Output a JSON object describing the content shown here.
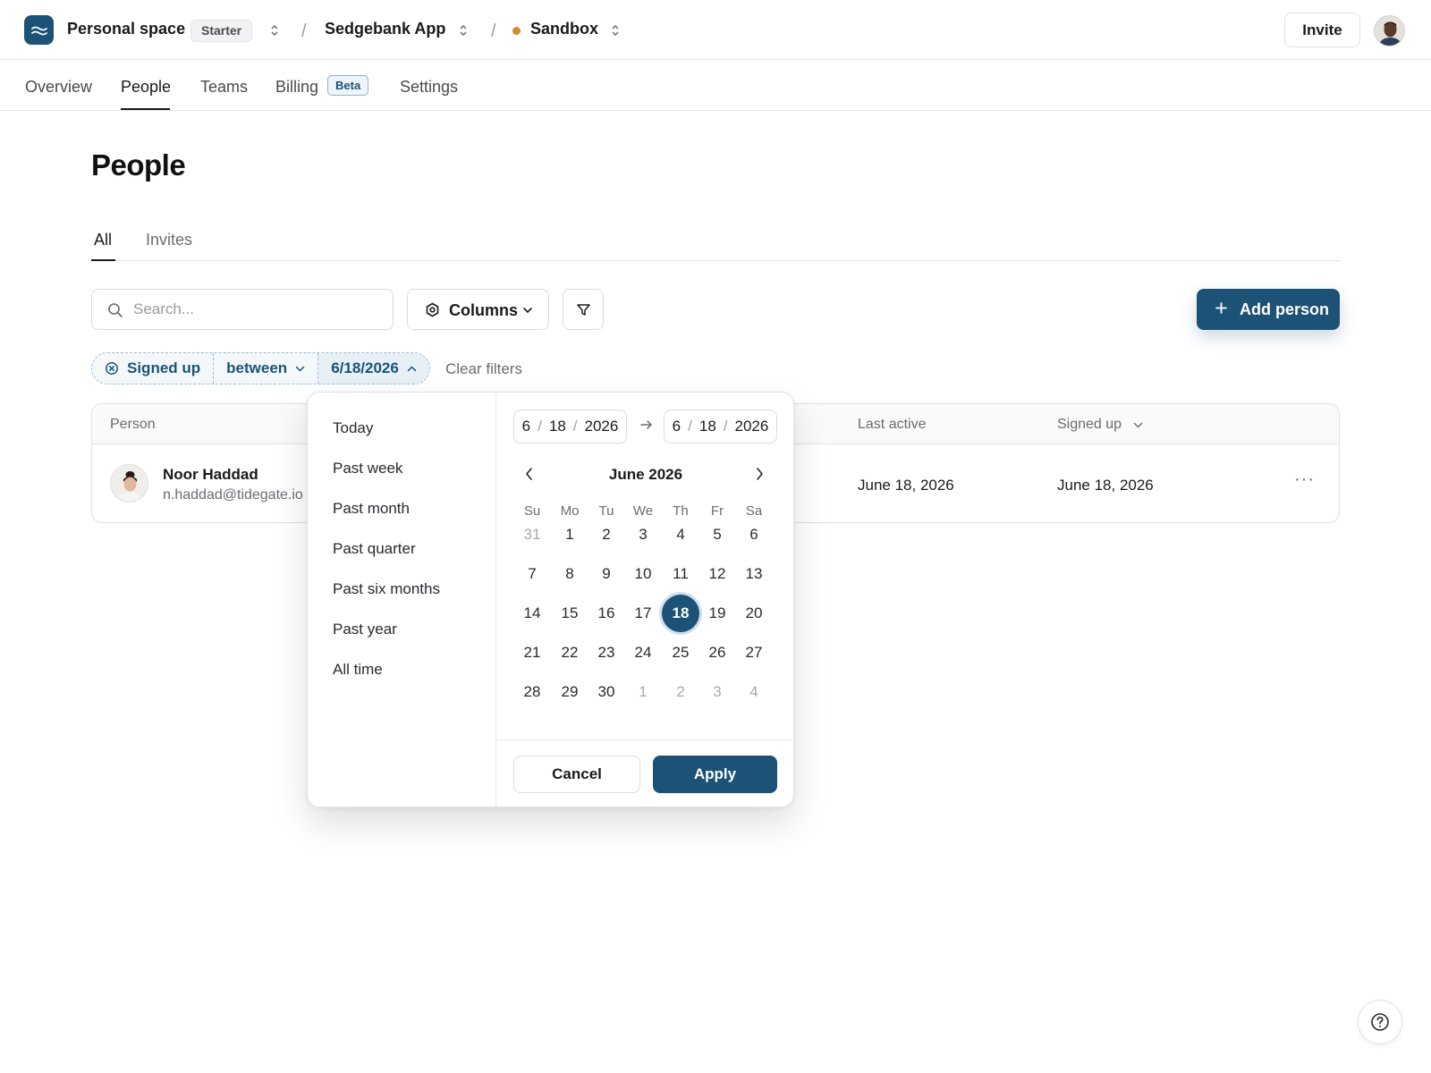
{
  "topbar": {
    "workspace": "Personal space",
    "plan": "Starter",
    "app": "Sedgebank App",
    "environment": "Sandbox",
    "environment_color": "#d18a2c",
    "invite_label": "Invite",
    "brand_color": "#1b5276"
  },
  "nav": {
    "tabs": [
      {
        "label": "Overview"
      },
      {
        "label": "People",
        "active": true
      },
      {
        "label": "Teams"
      },
      {
        "label": "Billing",
        "badge": "Beta"
      },
      {
        "label": "Settings"
      }
    ]
  },
  "page": {
    "title": "People",
    "subtabs": [
      {
        "label": "All",
        "active": true
      },
      {
        "label": "Invites"
      }
    ]
  },
  "toolbar": {
    "search_placeholder": "Search...",
    "columns_label": "Columns",
    "add_label": "Add person"
  },
  "filter": {
    "field": "Signed up",
    "operator": "between",
    "value": "6/18/2026",
    "clear_label": "Clear filters"
  },
  "table": {
    "headers": [
      "Person",
      "Last active",
      "Signed up"
    ],
    "rows": [
      {
        "name": "Noor Haddad",
        "email": "n.haddad@tidegate.io",
        "last_active": "June 18, 2026",
        "signed_up": "June 18, 2026",
        "more": "···"
      }
    ]
  },
  "datepicker": {
    "presets": [
      "Today",
      "Past week",
      "Past month",
      "Past quarter",
      "Past six months",
      "Past year",
      "All time"
    ],
    "start": {
      "m": "6",
      "d": "18",
      "y": "2026"
    },
    "end": {
      "m": "6",
      "d": "18",
      "y": "2026"
    },
    "month_title": "June 2026",
    "weekdays": [
      "Su",
      "Mo",
      "Tu",
      "We",
      "Th",
      "Fr",
      "Sa"
    ],
    "weeks": [
      [
        "31",
        "1",
        "2",
        "3",
        "4",
        "5",
        "6"
      ],
      [
        "7",
        "8",
        "9",
        "10",
        "11",
        "12",
        "13"
      ],
      [
        "14",
        "15",
        "16",
        "17",
        "18",
        "19",
        "20"
      ],
      [
        "21",
        "22",
        "23",
        "24",
        "25",
        "26",
        "27"
      ],
      [
        "28",
        "29",
        "30",
        "1",
        "2",
        "3",
        "4"
      ]
    ],
    "selected_day": "18",
    "cancel_label": "Cancel",
    "apply_label": "Apply"
  }
}
